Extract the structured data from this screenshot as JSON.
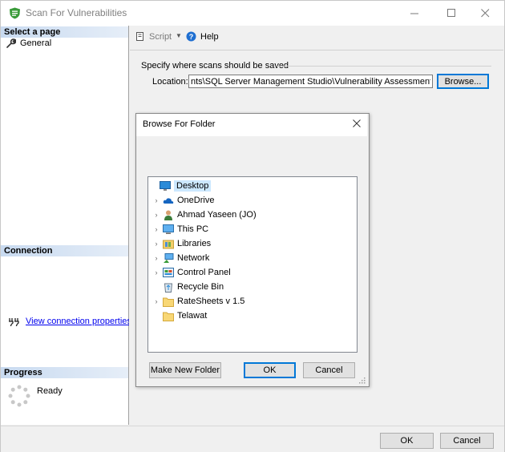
{
  "window": {
    "title": "Scan For Vulnerabilities"
  },
  "left_pane": {
    "select_page_header": "Select a page",
    "pages": [
      {
        "label": "General"
      }
    ],
    "connection_header": "Connection",
    "connection_link": "View connection properties",
    "progress_header": "Progress",
    "progress_status": "Ready"
  },
  "toolbar": {
    "script_label": "Script",
    "help_label": "Help"
  },
  "main": {
    "group_label": "Specify where scans should be saved",
    "location_label": "Location:",
    "location_value": "nts\\SQL Server Management Studio\\Vulnerability Assessment Reports",
    "browse_label": "Browse..."
  },
  "dialog": {
    "title": "Browse For Folder",
    "items": [
      {
        "label": "Desktop",
        "icon": "desktop-icon",
        "expandable": false,
        "selected": true
      },
      {
        "label": "OneDrive",
        "icon": "onedrive-icon",
        "expandable": true
      },
      {
        "label": "Ahmad Yaseen (JO)",
        "icon": "user-icon",
        "expandable": true
      },
      {
        "label": "This PC",
        "icon": "computer-icon",
        "expandable": true
      },
      {
        "label": "Libraries",
        "icon": "libraries-icon",
        "expandable": true
      },
      {
        "label": "Network",
        "icon": "network-icon",
        "expandable": true
      },
      {
        "label": "Control Panel",
        "icon": "control-panel-icon",
        "expandable": true
      },
      {
        "label": "Recycle Bin",
        "icon": "recycle-bin-icon",
        "expandable": false
      },
      {
        "label": "RateSheets v 1.5",
        "icon": "folder-icon",
        "expandable": true
      },
      {
        "label": "Telawat",
        "icon": "folder-icon",
        "expandable": false
      }
    ],
    "make_new_folder_label": "Make New Folder",
    "ok_label": "OK",
    "cancel_label": "Cancel"
  },
  "footer": {
    "ok_label": "OK",
    "cancel_label": "Cancel"
  },
  "colors": {
    "accent": "#0078d7",
    "section_header": "#c8daf0",
    "link": "#0000ee"
  }
}
